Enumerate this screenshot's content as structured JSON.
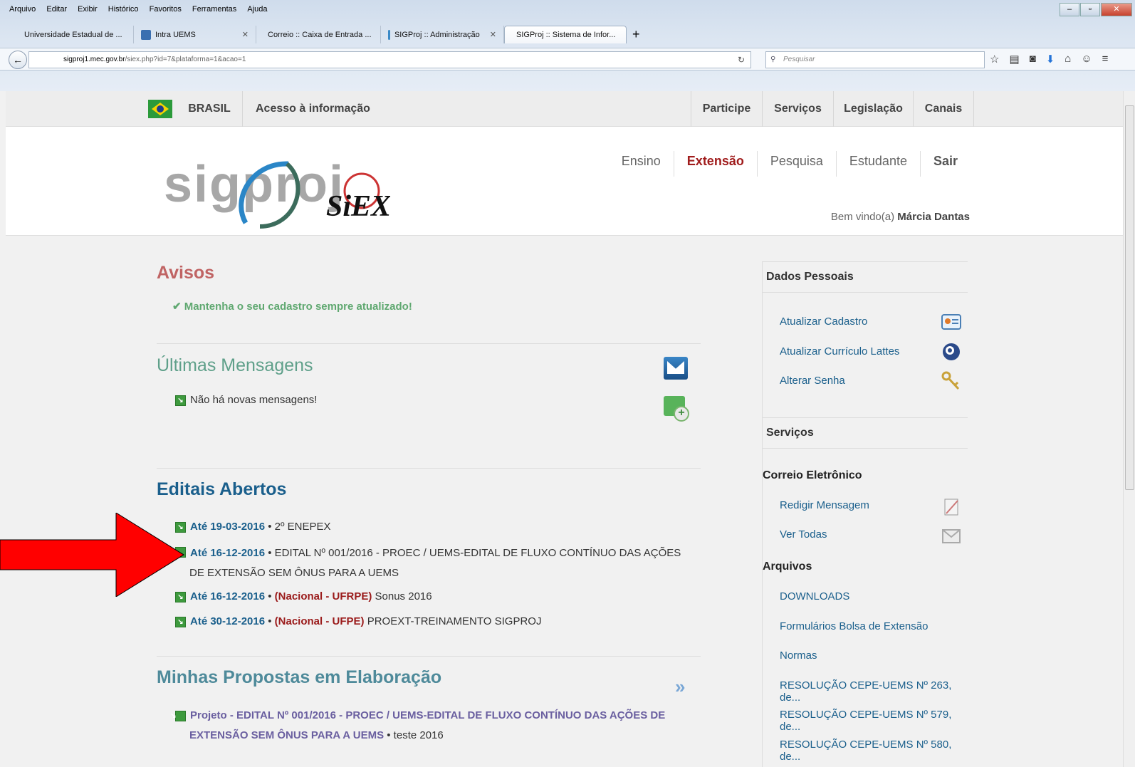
{
  "browser": {
    "menu": [
      "Arquivo",
      "Editar",
      "Exibir",
      "Histórico",
      "Favoritos",
      "Ferramentas",
      "Ajuda"
    ],
    "tabs": [
      {
        "label": "Universidade Estadual de ...",
        "icon": "uems-favicon",
        "color": "#d42a1a"
      },
      {
        "label": "Intra UEMS",
        "icon": "intra-favicon",
        "color": "#3a6fb0"
      },
      {
        "label": "Correio :: Caixa de Entrada ...",
        "icon": "mail-favicon",
        "color": "#7aa32a"
      },
      {
        "label": "SIGProj :: Administração",
        "icon": "sigproj-favicon",
        "color": "#3a8ac7"
      },
      {
        "label": "SIGProj :: Sistema de Infor...",
        "icon": "sigproj-favicon",
        "color": "#3a8ac7"
      }
    ],
    "new_tab": "+",
    "url_domain": "sigproj1.mec.gov.br",
    "url_prefix": "",
    "url_path": "/siex.php?id=7&plataforma=1&acao=1",
    "search_placeholder": "Pesquisar"
  },
  "gov": {
    "brasil": "BRASIL",
    "acesso": "Acesso à informação",
    "links": [
      "Participe",
      "Serviços",
      "Legislação",
      "Canais"
    ]
  },
  "header": {
    "logo": "sigproj",
    "nav": [
      "Ensino",
      "Extensão",
      "Pesquisa",
      "Estudante",
      "Sair"
    ],
    "welcome_prefix": "Bem vindo(a)",
    "user_name": "Márcia Dantas"
  },
  "main": {
    "avisos_title": "Avisos",
    "aviso_text": "Mantenha o seu cadastro sempre atualizado!",
    "mensagens_title": "Últimas Mensagens",
    "mensagens_empty": "Não há novas mensagens!",
    "editais_title": "Editais Abertos",
    "editais": [
      {
        "date": "Até 19-03-2016",
        "sep": " • ",
        "tag": "",
        "text": "2º ENEPEX"
      },
      {
        "date": "Até 16-12-2016",
        "sep": " • ",
        "tag": "",
        "text": "EDITAL Nº 001/2016 - PROEC / UEMS-EDITAL DE FLUXO CONTÍNUO DAS AÇÕES DE EXTENSÃO SEM ÔNUS PARA A UEMS"
      },
      {
        "date": "Até 16-12-2016",
        "sep": " • ",
        "tag": "(Nacional - UFRPE)",
        "text": " Sonus 2016"
      },
      {
        "date": "Até 30-12-2016",
        "sep": " • ",
        "tag": "(Nacional - UFPE)",
        "text": " PROEXT-TREINAMENTO SIGPROJ"
      }
    ],
    "propostas_title": "Minhas Propostas em Elaboração",
    "proposta_text": "Projeto - EDITAL Nº 001/2016 - PROEC / UEMS-EDITAL DE FLUXO CONTÍNUO DAS AÇÕES DE EXTENSÃO SEM ÔNUS PARA A UEMS",
    "proposta_suffix": " • teste 2016"
  },
  "sidebar": {
    "dados_title": "Dados Pessoais",
    "dados_links": [
      "Atualizar Cadastro",
      "Atualizar Currículo Lattes",
      "Alterar Senha"
    ],
    "servicos_title": "Serviços",
    "correio_title": "Correio Eletrônico",
    "correio_links": [
      "Redigir Mensagem",
      "Ver Todas"
    ],
    "arquivos_title": "Arquivos",
    "arquivos_links": [
      "DOWNLOADS",
      "Formulários Bolsa de Extensão",
      "Normas",
      "RESOLUÇÃO CEPE-UEMS Nº 263, de...",
      "RESOLUÇÃO CEPE-UEMS Nº 579, de...",
      "RESOLUÇÃO CEPE-UEMS Nº 580, de..."
    ]
  },
  "colors": {
    "annotation_arrow": "#ff0000",
    "active_nav": "#a01c1c",
    "link": "#1a5f8c"
  }
}
